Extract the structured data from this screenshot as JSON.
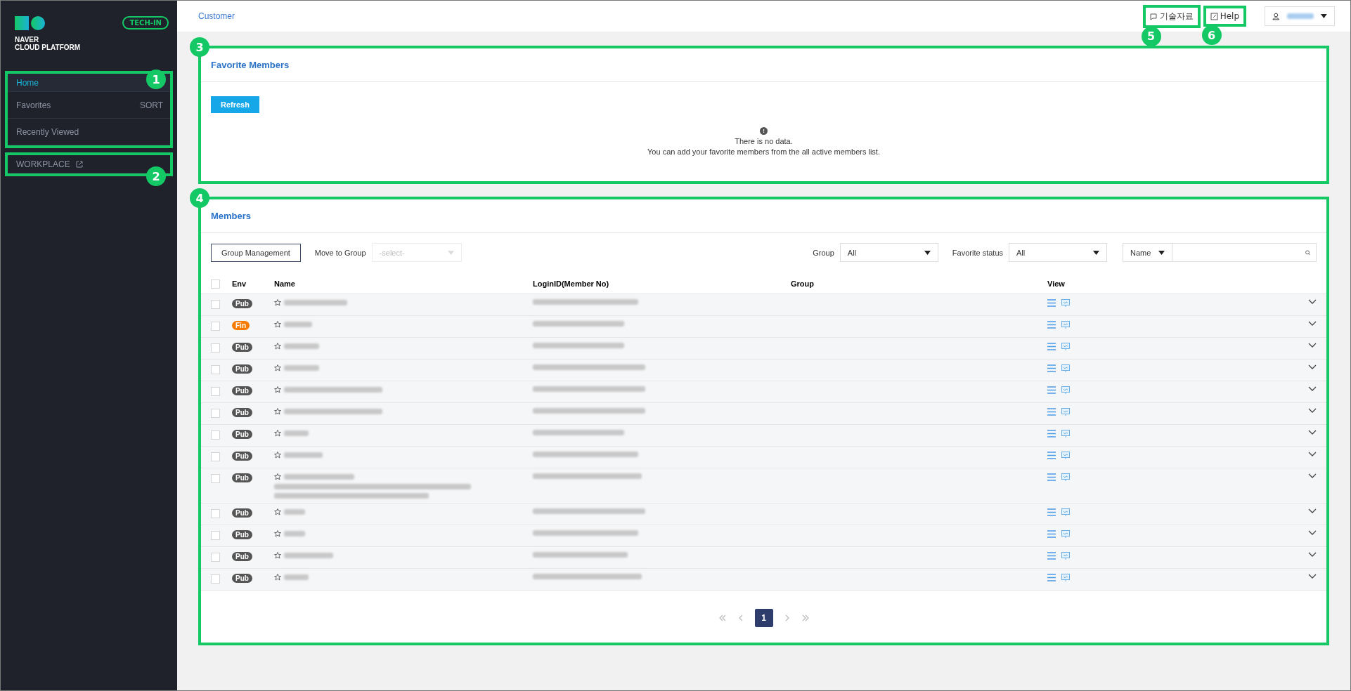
{
  "sidebar": {
    "logo": {
      "line_1": "NAVER",
      "line_2": "CLOUD PLATFORM"
    },
    "badge": "TECH-IN",
    "annotation": "1",
    "items": [
      {
        "label": "Home",
        "selected": true
      },
      {
        "label": "Favorites",
        "selected": false,
        "action": "SORT"
      },
      {
        "label": "Recently Viewed",
        "selected": false
      }
    ],
    "workplace": {
      "label": "WORKPLACE",
      "annotation": "2"
    }
  },
  "header": {
    "breadcrumb": "Customer",
    "links": [
      {
        "label": "기술자료",
        "kind": "docs",
        "annotation": "5"
      },
      {
        "label": "Help",
        "kind": "help",
        "annotation": "6"
      }
    ]
  },
  "favorites_panel": {
    "title": "Favorite Members",
    "annotation": "3",
    "refresh": "Refresh",
    "empty_icon": "!",
    "empty_title": "There is no data.",
    "empty_text": "You can add your favorite members from the all active members list."
  },
  "members_panel": {
    "title": "Members",
    "annotation": "4",
    "group_management": "Group Management",
    "move_to_group": "Move to Group",
    "move_placeholder": "-select-",
    "group_label": "Group",
    "group_value": "All",
    "favorite_label": "Favorite status",
    "favorite_value": "All",
    "search_type": "Name",
    "select_all": {
      "checked": false
    },
    "columns": [
      "Env",
      "Name",
      "LoginID(Member No)",
      "Group",
      "View"
    ],
    "rows": [
      {
        "env": "Pub",
        "color": "#555555",
        "kind": "single",
        "checked": false
      },
      {
        "env": "Fin",
        "color": "#f57c00",
        "kind": "single",
        "checked": false
      },
      {
        "env": "Pub",
        "color": "#555555",
        "kind": "single",
        "checked": false
      },
      {
        "env": "Pub",
        "color": "#555555",
        "kind": "single",
        "checked": false
      },
      {
        "env": "Pub",
        "color": "#555555",
        "kind": "single",
        "checked": false
      },
      {
        "env": "Pub",
        "color": "#555555",
        "kind": "single",
        "checked": false
      },
      {
        "env": "Pub",
        "color": "#555555",
        "kind": "single",
        "checked": false
      },
      {
        "env": "Pub",
        "color": "#555555",
        "kind": "single",
        "checked": false
      },
      {
        "env": "Pub",
        "color": "#555555",
        "kind": "multiline",
        "checked": false
      },
      {
        "env": "Pub",
        "color": "#555555",
        "kind": "single",
        "checked": false
      },
      {
        "env": "Pub",
        "color": "#555555",
        "kind": "single",
        "checked": false
      },
      {
        "env": "Pub",
        "color": "#555555",
        "kind": "single",
        "checked": false
      },
      {
        "env": "Pub",
        "color": "#555555",
        "kind": "single",
        "checked": false
      }
    ],
    "pagination": {
      "pages": [
        {
          "label": "1",
          "selected": true
        }
      ]
    }
  }
}
